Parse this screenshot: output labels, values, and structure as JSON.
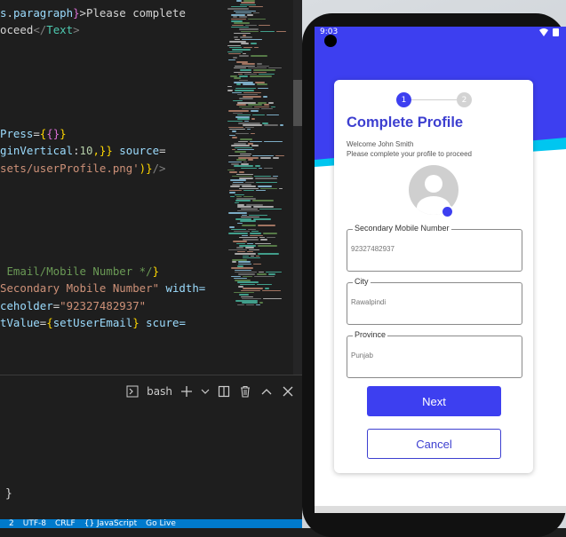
{
  "editor": {
    "lines": [
      [
        {
          "t": "s",
          "c": "tk-var"
        },
        {
          "t": ".",
          "c": "tk-txt"
        },
        {
          "t": "paragraph",
          "c": "tk-var"
        },
        {
          "t": "}",
          "c": "tk-br2"
        },
        {
          "t": ">Please complete",
          "c": "tk-txt"
        }
      ],
      [
        {
          "t": "oceed",
          "c": "tk-txt"
        },
        {
          "t": "</",
          "c": "tk-pun"
        },
        {
          "t": "Text",
          "c": "tk-tag"
        },
        {
          "t": ">",
          "c": "tk-pun"
        }
      ],
      [],
      [],
      [],
      [],
      [],
      [
        {
          "t": "Press",
          "c": "tk-var"
        },
        {
          "t": "=",
          "c": "tk-txt"
        },
        {
          "t": "{",
          "c": "tk-br"
        },
        {
          "t": "{}",
          "c": "tk-br2"
        },
        {
          "t": "}",
          "c": "tk-br"
        }
      ],
      [
        {
          "t": "ginVertical",
          "c": "tk-var"
        },
        {
          "t": ":",
          "c": "tk-txt"
        },
        {
          "t": "10",
          "c": "tk-num"
        },
        {
          "t": ",}} ",
          "c": "tk-br"
        },
        {
          "t": "source",
          "c": "tk-var"
        },
        {
          "t": "=",
          "c": "tk-txt"
        }
      ],
      [
        {
          "t": "sets/userProfile.png'",
          "c": "tk-str"
        },
        {
          "t": ")}",
          "c": "tk-br"
        },
        {
          "t": "/>",
          "c": "tk-pun"
        }
      ],
      [],
      [],
      [],
      [],
      [],
      [
        {
          "t": " Email/Mobile Number */",
          "c": "tk-com"
        },
        {
          "t": "}",
          "c": "tk-br"
        }
      ],
      [
        {
          "t": "Secondary Mobile Number\"",
          "c": "tk-str"
        },
        {
          "t": " width=",
          "c": "tk-var"
        }
      ],
      [
        {
          "t": "ceholder",
          "c": "tk-var"
        },
        {
          "t": "=",
          "c": "tk-txt"
        },
        {
          "t": "\"92327482937\"",
          "c": "tk-str"
        }
      ],
      [
        {
          "t": "tValue",
          "c": "tk-var"
        },
        {
          "t": "=",
          "c": "tk-txt"
        },
        {
          "t": "{",
          "c": "tk-br"
        },
        {
          "t": "setUserEmail",
          "c": "tk-var"
        },
        {
          "t": "} ",
          "c": "tk-br"
        },
        {
          "t": "scure=",
          "c": "tk-var"
        }
      ]
    ]
  },
  "terminal": {
    "shell_label": "bash",
    "brace": "}"
  },
  "statusbar": {
    "items": [
      "2",
      "UTF-8",
      "CRLF",
      "{} JavaScript",
      "Go Live"
    ]
  },
  "phone": {
    "status_time": "9:03",
    "step1": "1",
    "step2": "2",
    "title": "Complete Profile",
    "welcome": "Welcome John Smith",
    "instruction": "Please complete your profile to proceed",
    "fields": {
      "secondary_mobile": {
        "label": "Secondary Mobile Number",
        "placeholder": "92327482937"
      },
      "city": {
        "label": "City",
        "placeholder": "Rawalpindi"
      },
      "province": {
        "label": "Province",
        "placeholder": "Punjab"
      }
    },
    "next_label": "Next",
    "cancel_label": "Cancel"
  },
  "colors": {
    "primary": "#3d3ff0",
    "accent_teal": "#00c6f0",
    "vscode_blue": "#007acc"
  }
}
